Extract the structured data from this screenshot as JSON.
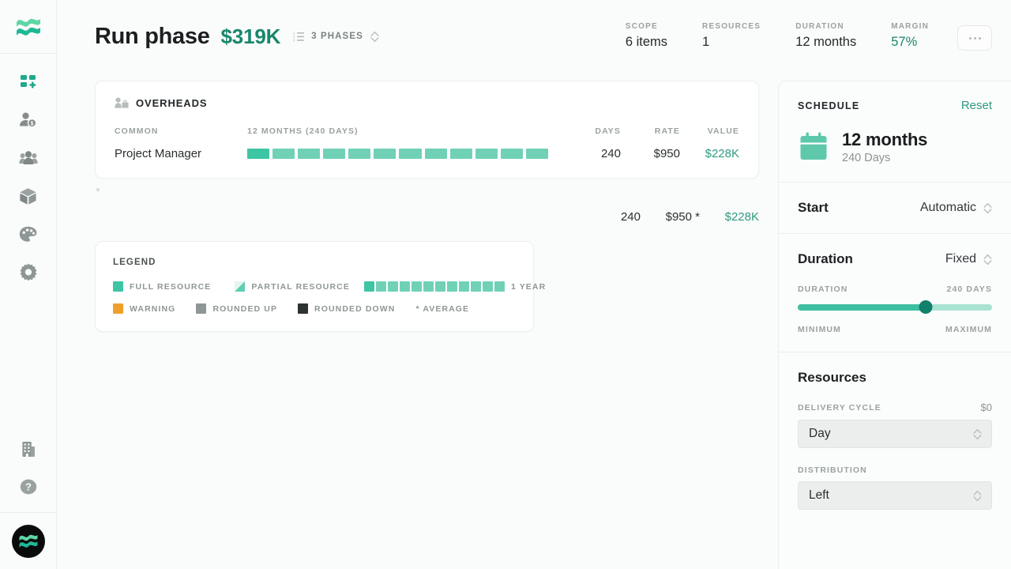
{
  "brand": {
    "logo_icon": "waves-logo-icon",
    "accent": "#3ec5a4",
    "accent_dark": "#18876c"
  },
  "sidebar": {
    "items": [
      {
        "icon": "dashboard-grid-plus-icon",
        "name": "sidebar-item-dashboard"
      },
      {
        "icon": "user-dollar-icon",
        "name": "sidebar-item-clients"
      },
      {
        "icon": "team-group-icon",
        "name": "sidebar-item-team"
      },
      {
        "icon": "package-box-icon",
        "name": "sidebar-item-products"
      },
      {
        "icon": "palette-icon",
        "name": "sidebar-item-branding"
      },
      {
        "icon": "gear-icon",
        "name": "sidebar-item-settings"
      }
    ],
    "bottom_items": [
      {
        "icon": "building-icon",
        "name": "sidebar-item-company"
      },
      {
        "icon": "help-question-icon",
        "name": "sidebar-item-help"
      }
    ],
    "avatar_icon": "waves-avatar-icon"
  },
  "header": {
    "title": "Run phase",
    "amount": "$319K",
    "phase_chip": {
      "icon": "ordered-list-icon",
      "label": "3 PHASES",
      "stepper_icon": "chevron-updown-icon"
    },
    "metrics": [
      {
        "label": "SCOPE",
        "value": "6 items",
        "accent": false
      },
      {
        "label": "RESOURCES",
        "value": "1",
        "accent": false
      },
      {
        "label": "DURATION",
        "value": "12 months",
        "accent": false
      },
      {
        "label": "MARGIN",
        "value": "57%",
        "accent": true
      }
    ],
    "more_button": "more-options-icon"
  },
  "overheads": {
    "icon": "person-briefcase-icon",
    "title": "OVERHEADS",
    "columns": {
      "name": "COMMON",
      "timeline": "12 MONTHS (240 DAYS)",
      "days": "DAYS",
      "rate": "RATE",
      "value": "VALUE"
    },
    "rows": [
      {
        "name": "Project Manager",
        "segments": 12,
        "first_segment_full": true,
        "days": "240",
        "rate": "$950",
        "value": "$228K"
      }
    ],
    "totals": {
      "days": "240",
      "rate": "$950 *",
      "value": "$228K"
    }
  },
  "legend": {
    "title": "LEGEND",
    "row1": [
      {
        "type": "swatch",
        "style": "full",
        "label": "FULL RESOURCE"
      },
      {
        "type": "swatch",
        "style": "partial",
        "label": "PARTIAL RESOURCE"
      },
      {
        "type": "bar",
        "segments": 12,
        "label": "1 YEAR"
      }
    ],
    "row2": [
      {
        "type": "swatch",
        "style": "warn",
        "label": "WARNING"
      },
      {
        "type": "swatch",
        "style": "up",
        "label": "ROUNDED UP"
      },
      {
        "type": "swatch",
        "style": "down",
        "label": "ROUNDED DOWN"
      },
      {
        "type": "text",
        "label": "* AVERAGE"
      }
    ]
  },
  "schedule": {
    "title": "SCHEDULE",
    "reset_label": "Reset",
    "calendar_icon": "calendar-icon",
    "duration_main": "12 months",
    "duration_sub": "240 Days",
    "start": {
      "label": "Start",
      "value": "Automatic",
      "stepper_icon": "chevron-updown-icon"
    },
    "duration": {
      "label": "Duration",
      "mode": "Fixed",
      "stepper_icon": "chevron-updown-icon",
      "slider_label": "DURATION",
      "slider_value_label": "240 DAYS",
      "slider_percent": 66,
      "min_label": "MINIMUM",
      "max_label": "MAXIMUM"
    },
    "resources": {
      "title": "Resources",
      "delivery_cycle_label": "DELIVERY CYCLE",
      "delivery_cycle_amount": "$0",
      "delivery_cycle_value": "Day",
      "distribution_label": "DISTRIBUTION",
      "distribution_value": "Left",
      "stepper_icon": "chevron-updown-icon"
    }
  }
}
